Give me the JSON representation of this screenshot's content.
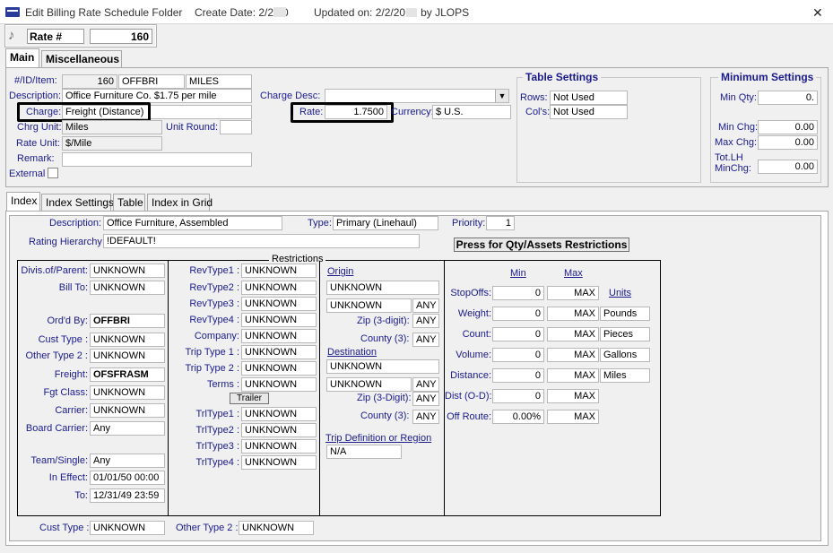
{
  "window": {
    "title": "Edit Billing Rate Schedule Folder",
    "create_date": "Create Date: 2/2/20",
    "updated_on": "Updated on: 2/2/20",
    "updated_by": "by  JLOPS",
    "close_glyph": "✕"
  },
  "header": {
    "rate_label": "Rate #",
    "rate_value": "160"
  },
  "top_tabs": [
    "Main",
    "Miscellaneous"
  ],
  "main": {
    "id_label": "#/ID/Item:",
    "id_number": "160",
    "id_code": "OFFBRI",
    "id_item": "MILES",
    "description_label": "Description:",
    "description_value": "Office Furniture Co. $1.75 per mile",
    "charge_label": "Charge:",
    "charge_value": "Freight (Distance)",
    "chrg_unit_label": "Chrg Unit:",
    "chrg_unit_value": "Miles",
    "unit_round_label": "Unit Round:",
    "unit_round_value": "",
    "rate_unit_label": "Rate Unit:",
    "rate_unit_value": "$/Mile",
    "remark_label": "Remark:",
    "remark_value": "",
    "external_label": "External",
    "charge_desc_label": "Charge Desc:",
    "charge_desc_value": "",
    "rate_label": "Rate:",
    "rate_value": "1.7500",
    "currency_label": "Currency:",
    "currency_value": "$ U.S."
  },
  "table_settings": {
    "title": "Table Settings",
    "rows_label": "Rows:",
    "rows_value": "Not Used",
    "cols_label": "Col's:",
    "cols_value": "Not Used"
  },
  "minimum_settings": {
    "title": "Minimum Settings",
    "min_qty_label": "Min Qty:",
    "min_qty_value": "0.",
    "min_chg_label": "Min Chg:",
    "min_chg_value": "0.00",
    "max_chg_label": "Max Chg:",
    "max_chg_value": "0.00",
    "tot_lh_label_1": "Tot.LH",
    "tot_lh_label_2": "MinChg:",
    "tot_lh_value": "0.00"
  },
  "lower_tabs": [
    "Index",
    "Index Settings",
    "Table",
    "Index in Grid"
  ],
  "index": {
    "description_label": "Description:",
    "description_value": "Office Furniture, Assembled",
    "type_label": "Type:",
    "type_value": "Primary (Linehaul)",
    "priority_label": "Priority:",
    "priority_value": "1",
    "rating_hierarchy_label": "Rating Hierarchy",
    "rating_hierarchy_value": "!DEFAULT!",
    "qty_button": "Press for Qty/Assets Restrictions",
    "restrictions_title": "Restrictions",
    "left_col": [
      {
        "label": "Divis.of/Parent:",
        "value": "UNKNOWN",
        "bold": false
      },
      {
        "label": "Bill To:",
        "value": "UNKNOWN",
        "bold": false
      },
      {
        "label": "Ord'd By:",
        "value": "OFFBRI",
        "bold": true
      },
      {
        "label": "Cust Type :",
        "value": "UNKNOWN",
        "bold": false
      },
      {
        "label": "Other Type 2 :",
        "value": "UNKNOWN",
        "bold": false
      },
      {
        "label": "Freight:",
        "value": "OFSFRASM",
        "bold": true
      },
      {
        "label": "Fgt Class:",
        "value": "UNKNOWN",
        "bold": false
      },
      {
        "label": "Carrier:",
        "value": "UNKNOWN",
        "bold": false
      },
      {
        "label": "Board Carrier:",
        "value": "Any",
        "bold": false
      },
      {
        "label": "Team/Single:",
        "value": "Any",
        "bold": false
      },
      {
        "label": "In Effect:",
        "value": "01/01/50 00:00",
        "bold": false
      },
      {
        "label": "To:",
        "value": "12/31/49 23:59",
        "bold": false
      }
    ],
    "mid_col": [
      {
        "label": "RevType1 :",
        "value": "UNKNOWN"
      },
      {
        "label": "RevType2 :",
        "value": "UNKNOWN"
      },
      {
        "label": "RevType3 :",
        "value": "UNKNOWN"
      },
      {
        "label": "RevType4 :",
        "value": "UNKNOWN"
      },
      {
        "label": "Company:",
        "value": "UNKNOWN"
      },
      {
        "label": "Trip Type 1 :",
        "value": "UNKNOWN"
      },
      {
        "label": "Trip Type 2 :",
        "value": "UNKNOWN"
      },
      {
        "label": "Terms :",
        "value": "UNKNOWN"
      }
    ],
    "trailer_button": "Trailer",
    "trl_col": [
      {
        "label": "TrlType1 :",
        "value": "UNKNOWN"
      },
      {
        "label": "TrlType2 :",
        "value": "UNKNOWN"
      },
      {
        "label": "TrlType3 :",
        "value": "UNKNOWN"
      },
      {
        "label": "TrlType4 :",
        "value": "UNKNOWN"
      }
    ],
    "origin": {
      "link": "Origin",
      "value1": "UNKNOWN",
      "value2": "UNKNOWN",
      "any1": "ANY",
      "zip_label": "Zip (3-digit):",
      "zip_value": "ANY",
      "county_label": "County (3):",
      "county_value": "ANY"
    },
    "destination": {
      "link": "Destination",
      "value1": "UNKNOWN",
      "value2": "UNKNOWN",
      "any1": "ANY",
      "zip_label": "Zip (3-Digit):",
      "zip_value": "ANY",
      "county_label": "County (3):",
      "county_value": "ANY"
    },
    "trip_def": {
      "link": "Trip Definition or Region",
      "value": "N/A"
    },
    "qty_table": {
      "min_header": "Min",
      "max_header": "Max",
      "units_header": "Units",
      "rows": [
        {
          "label": "StopOffs:",
          "min": "0",
          "max": "MAX",
          "unit": null
        },
        {
          "label": "Weight:",
          "min": "0",
          "max": "MAX",
          "unit": "Pounds"
        },
        {
          "label": "Count:",
          "min": "0",
          "max": "MAX",
          "unit": "Pieces"
        },
        {
          "label": "Volume:",
          "min": "0",
          "max": "MAX",
          "unit": "Gallons"
        },
        {
          "label": "Distance:",
          "min": "0",
          "max": "MAX",
          "unit": "Miles"
        },
        {
          "label": "Dist (O-D):",
          "min": "0",
          "max": "MAX",
          "unit": null
        },
        {
          "label": "Off Route:",
          "min": "0.00%",
          "max": "MAX",
          "unit": null
        }
      ]
    },
    "bottom_cust_type_label": "Cust Type :",
    "bottom_cust_type_value": "UNKNOWN",
    "bottom_other_type_label": "Other Type 2 :",
    "bottom_other_type_value": "UNKNOWN"
  }
}
